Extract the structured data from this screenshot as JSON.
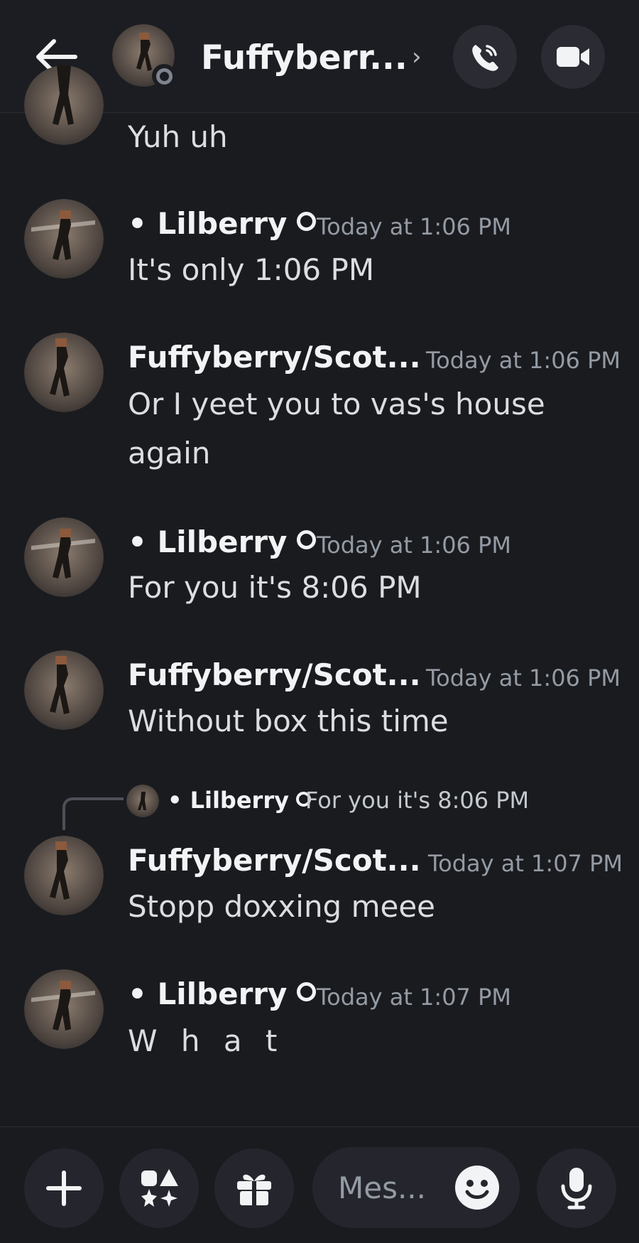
{
  "header": {
    "title": "Fuffyberr...",
    "chevron": "›",
    "back_icon": "arrow-left-icon",
    "call_icon": "phone-call-icon",
    "video_icon": "video-camera-icon"
  },
  "messages": [
    {
      "text": "Yuh uh"
    },
    {
      "author": "• Lilberry",
      "timestamp": "Today at 1:06 PM",
      "lines": [
        "It's only 1:06 PM"
      ]
    },
    {
      "author": "Fuffyberry/Scot...",
      "timestamp": "Today at 1:06 PM",
      "lines": [
        "Or I yeet you to vas's house",
        "again"
      ]
    },
    {
      "author": "• Lilberry",
      "timestamp": "Today at 1:06 PM",
      "lines": [
        "For you it's 8:06 PM"
      ]
    },
    {
      "author": "Fuffyberry/Scot...",
      "timestamp": "Today at 1:06 PM",
      "lines": [
        "Without box this time"
      ]
    },
    {
      "reply": {
        "author": "• Lilberry",
        "text": "For you it's 8:06 PM"
      },
      "author": "Fuffyberry/Scot...",
      "timestamp": "Today at 1:07 PM",
      "lines": [
        "Stopp doxxing meee"
      ]
    },
    {
      "author": "• Lilberry",
      "timestamp": "Today at 1:07 PM",
      "lines": [
        "W h a t"
      ]
    }
  ],
  "composer": {
    "placeholder": "Mes...",
    "icons": [
      "plus-icon",
      "apps-icon",
      "gift-icon",
      "emoji-icon",
      "microphone-icon"
    ]
  },
  "colors": {
    "background": "#1a1b1f",
    "button": "#25262d",
    "text": "#dbdee1",
    "timestamp": "#949ba4"
  }
}
